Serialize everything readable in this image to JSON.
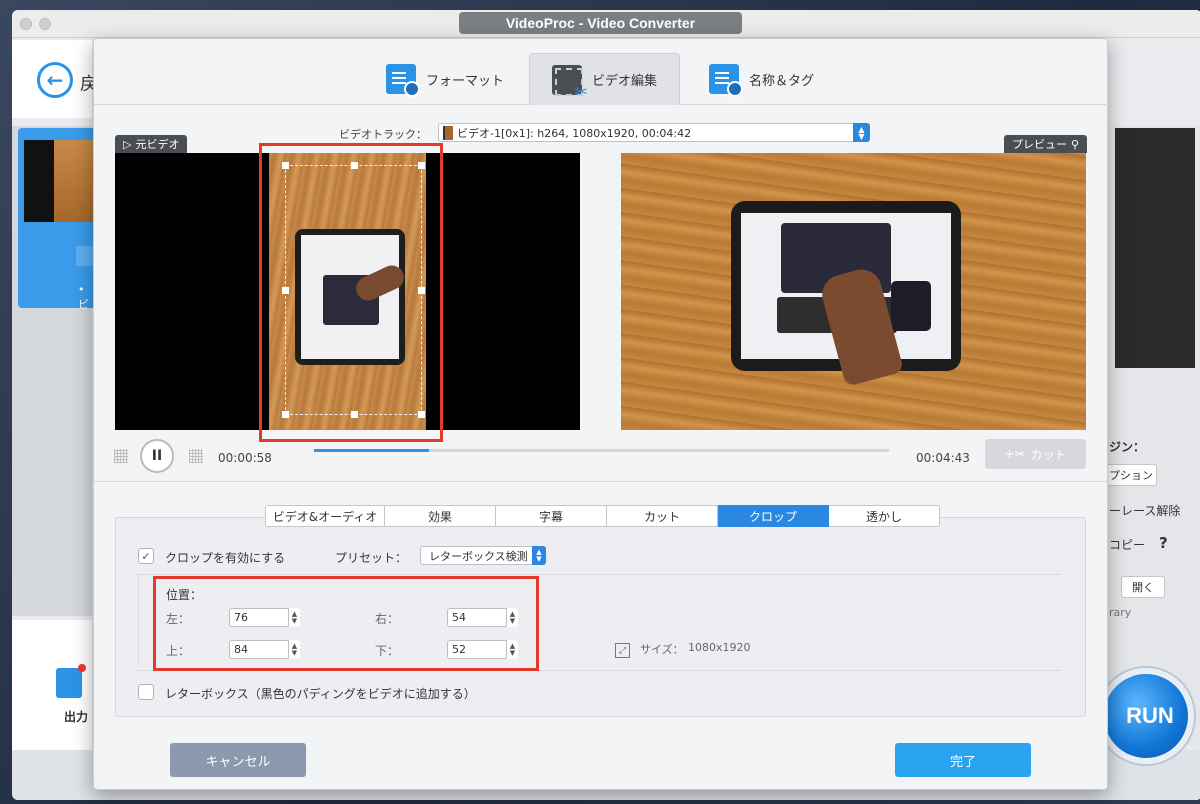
{
  "app": {
    "window_title": "VideoProc - Video Converter",
    "back_label": "戻",
    "output_label": "出力",
    "thumb_marker": "• ビ",
    "run_label": "RUN"
  },
  "right_panel": {
    "heading": "ジン：",
    "option_btn": "プション",
    "deinterlace": "ーレース解除",
    "copy": "コピー",
    "help": "?",
    "open_btn": "開く",
    "library": "rary"
  },
  "dialog": {
    "tabs": [
      {
        "label": "フォーマット",
        "icon": "format-doc-icon"
      },
      {
        "label": "ビデオ編集",
        "icon": "video-edit-icon"
      },
      {
        "label": "名称＆タグ",
        "icon": "name-tag-icon"
      }
    ],
    "track_label": "ビデオトラック：",
    "track_value": "ビデオ-1[0x1]: h264, 1080x1920, 00:04:42",
    "source_tag": "元ビデオ",
    "preview_tag": "プレビュー",
    "current_time": "00:00:58",
    "total_time": "00:04:43",
    "progress": 0.2,
    "cut_label": "カット",
    "subtabs": [
      "ビデオ&オーディオ",
      "効果",
      "字幕",
      "カット",
      "クロップ",
      "透かし"
    ],
    "active_subtab": "クロップ",
    "crop": {
      "enable_label": "クロップを有効にする",
      "enabled": true,
      "preset_label": "プリセット：",
      "preset_value": "レターボックス検測",
      "position_label": "位置：",
      "left_label": "左：",
      "left": "76",
      "right_label": "右：",
      "right": "54",
      "top_label": "上：",
      "top": "84",
      "bottom_label": "下：",
      "bottom": "52",
      "size_label": "サイズ：",
      "size_value": "1080x1920",
      "letterbox_label": "レターボックス（黒色のパディングをビデオに追加する）",
      "letterbox": false
    },
    "cancel_label": "キャンセル",
    "done_label": "完了"
  },
  "colors": {
    "accent": "#2a93e6",
    "highlight": "#e53a28",
    "done": "#2aa3f0",
    "cancel": "#8b98ad"
  }
}
